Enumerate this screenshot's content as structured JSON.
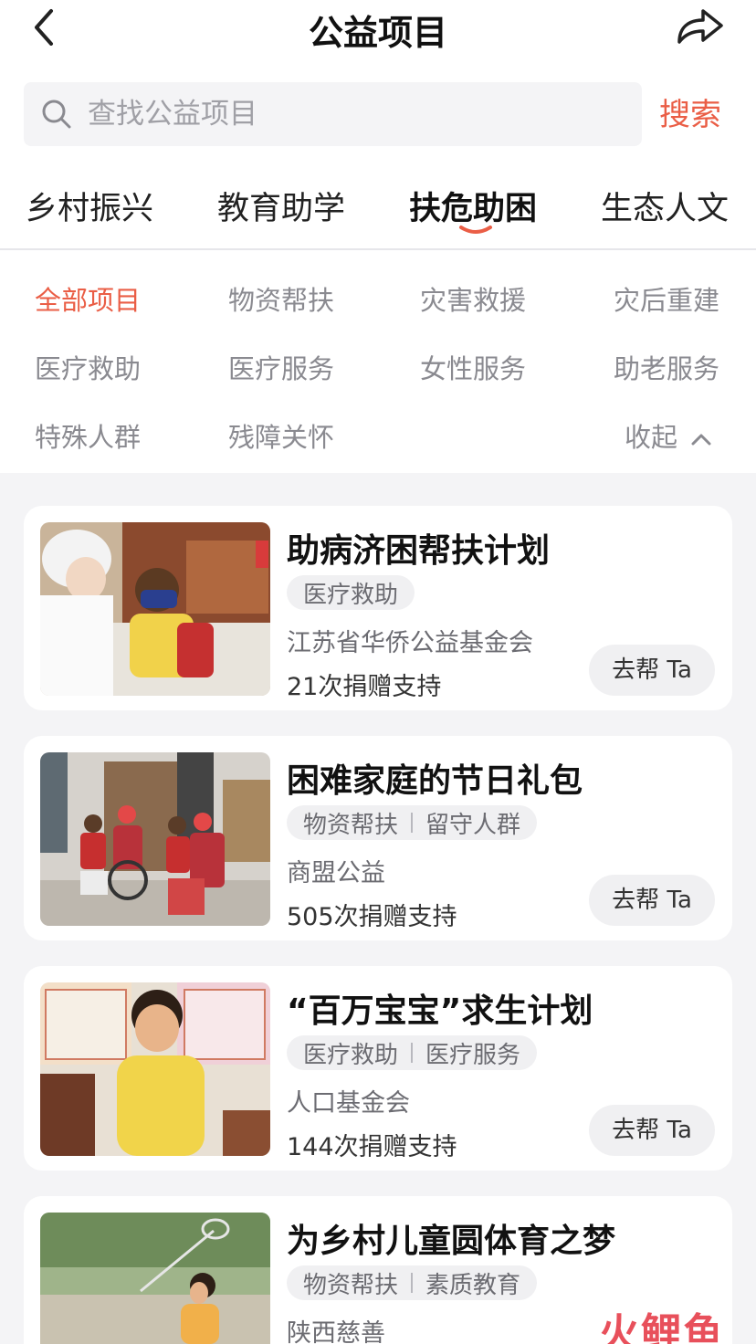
{
  "header": {
    "title": "公益项目"
  },
  "search": {
    "placeholder": "查找公益项目",
    "button": "搜索"
  },
  "tabs": [
    "乡村振兴",
    "教育助学",
    "扶危助困",
    "生态人文"
  ],
  "active_tab": "扶危助困",
  "subcategories": [
    "全部项目",
    "物资帮扶",
    "灾害救援",
    "灾后重建",
    "医疗救助",
    "医疗服务",
    "女性服务",
    "助老服务",
    "特殊人群",
    "残障关怀"
  ],
  "active_subcategory": "全部项目",
  "collapse_label": "收起",
  "accent_color": "#ea5e46",
  "projects": [
    {
      "title": "助病济困帮扶计划",
      "tags": [
        "医疗救助"
      ],
      "org": "江苏省华侨公益基金会",
      "count": "21次捐赠支持",
      "button": "去帮 Ta"
    },
    {
      "title": "困难家庭的节日礼包",
      "tags": [
        "物资帮扶",
        "留守人群"
      ],
      "org": "商盟公益",
      "count": "505次捐赠支持",
      "button": "去帮 Ta"
    },
    {
      "title": "“百万宝宝”求生计划",
      "tags": [
        "医疗救助",
        "医疗服务"
      ],
      "org": "人口基金会",
      "count": "144次捐赠支持",
      "button": "去帮 Ta"
    },
    {
      "title": "为乡村儿童圆体育之梦",
      "tags": [
        "物资帮扶",
        "素质教育"
      ],
      "org": "陕西慈善",
      "count": "",
      "button": ""
    }
  ],
  "watermark": "火鲤鱼"
}
